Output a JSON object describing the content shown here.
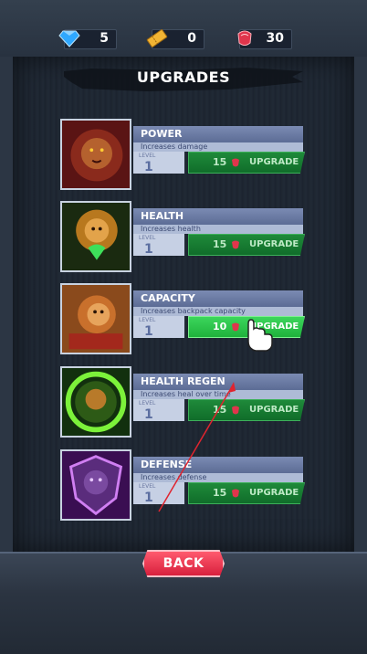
{
  "resources": [
    {
      "icon": "diamond-icon",
      "value": "5"
    },
    {
      "icon": "ticket-icon",
      "value": "0"
    },
    {
      "icon": "red-gem-icon",
      "value": "30"
    }
  ],
  "title": "UPGRADES",
  "level_label": "LEVEL",
  "upgrade_label": "UPGRADE",
  "upgrades": [
    {
      "name": "POWER",
      "description": "Increases damage",
      "level": "1",
      "cost": "15",
      "active": false
    },
    {
      "name": "HEALTH",
      "description": "Increases health",
      "level": "1",
      "cost": "15",
      "active": false
    },
    {
      "name": "CAPACITY",
      "description": "Increases backpack capacity",
      "level": "1",
      "cost": "10",
      "active": true
    },
    {
      "name": "HEALTH REGEN",
      "description": "Increases heal over time",
      "level": "1",
      "cost": "15",
      "active": false
    },
    {
      "name": "DEFENSE",
      "description": "Increases defense",
      "level": "1",
      "cost": "15",
      "active": false
    }
  ],
  "back_label": "BACK",
  "colors": {
    "accent_green": "#1fb23c",
    "back_red": "#d8203d"
  }
}
